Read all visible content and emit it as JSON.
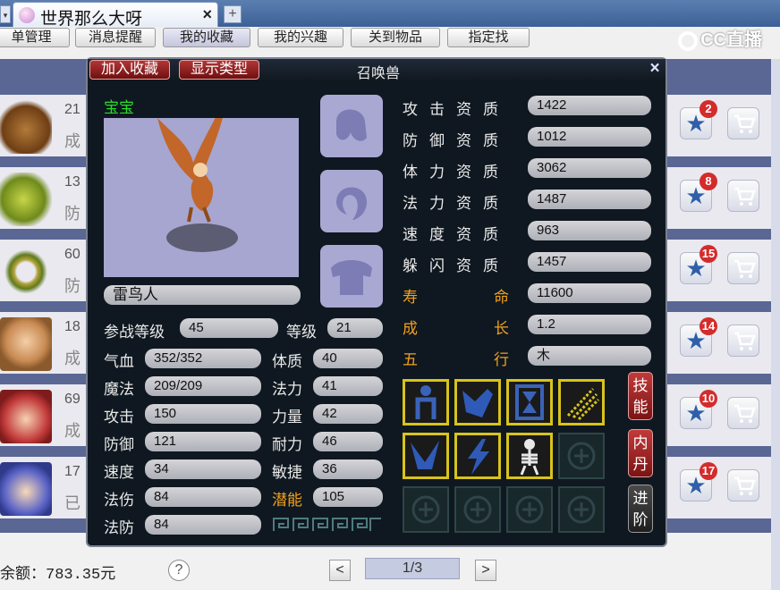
{
  "browser": {
    "tab_title": "世界那么大呀",
    "tab_close": "×",
    "new_tab": "+",
    "tab_arrow": "▾"
  },
  "nav": {
    "items": [
      "单管理",
      "消息提醒",
      "我的收藏",
      "我的兴趣",
      "关到物品",
      "指定找"
    ]
  },
  "stream_logo": "CC直播",
  "listing": {
    "rows": [
      {
        "line1": "21",
        "line2": "成",
        "badge": "2"
      },
      {
        "line1": "13",
        "line2": "防",
        "badge": "8"
      },
      {
        "line1": "60",
        "line2": "防",
        "badge": "15"
      },
      {
        "line1": "18",
        "line2": "成",
        "badge": "14"
      },
      {
        "line1": "69",
        "line2": "成",
        "badge": "10"
      },
      {
        "line1": "17",
        "line2": "已",
        "badge": "17"
      }
    ]
  },
  "footer": {
    "balance": "余额：783.35元",
    "help": "?",
    "prev": "<",
    "page": "1/3",
    "next": ">"
  },
  "pet_panel": {
    "add_favorite": "加入收藏",
    "show_type": "显示类型",
    "title": "召唤兽",
    "close": "×",
    "baby_label": "宝宝",
    "pet_name": "雷鸟人",
    "combat_level_label": "参战等级",
    "combat_level": "45",
    "level_label": "等级",
    "level": "21",
    "aptitudes": [
      {
        "label": "攻击资质",
        "value": "1422"
      },
      {
        "label": "防御资质",
        "value": "1012"
      },
      {
        "label": "体力资质",
        "value": "3062"
      },
      {
        "label": "法力资质",
        "value": "1487"
      },
      {
        "label": "速度资质",
        "value": "963"
      },
      {
        "label": "躲闪资质",
        "value": "1457"
      }
    ],
    "lifespan_label_a": "寿",
    "lifespan_label_b": "命",
    "lifespan": "11600",
    "growth_label_a": "成",
    "growth_label_b": "长",
    "growth": "1.2",
    "element_label_a": "五",
    "element_label_b": "行",
    "element": "木",
    "stats_left": [
      {
        "label": "气血",
        "value": "352/352"
      },
      {
        "label": "魔法",
        "value": "209/209"
      },
      {
        "label": "攻击",
        "value": "150"
      },
      {
        "label": "防御",
        "value": "121"
      },
      {
        "label": "速度",
        "value": "34"
      },
      {
        "label": "法伤",
        "value": "84"
      },
      {
        "label": "法防",
        "value": "84"
      }
    ],
    "stats_right": [
      {
        "label": "体质",
        "value": "40"
      },
      {
        "label": "法力",
        "value": "41"
      },
      {
        "label": "力量",
        "value": "42"
      },
      {
        "label": "耐力",
        "value": "46"
      },
      {
        "label": "敏捷",
        "value": "36"
      },
      {
        "label": "潜能",
        "value": "105"
      }
    ],
    "side_buttons": [
      "技能",
      "内丹",
      "进阶"
    ]
  },
  "colors": {
    "accent_red": "#b23636",
    "potential_orange": "#f2a01c",
    "baby_green": "#2bdc2b",
    "skill_border": "#d8c41a"
  }
}
